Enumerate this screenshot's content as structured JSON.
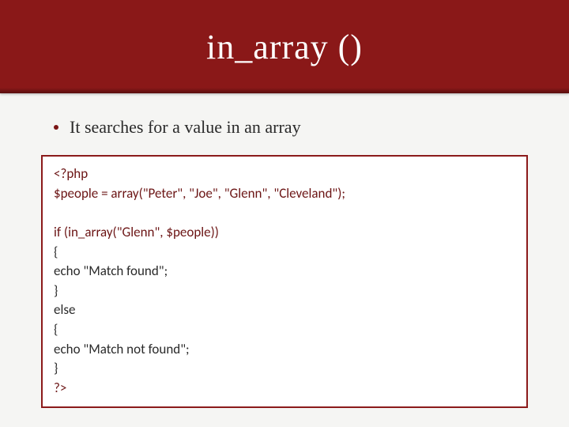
{
  "header": {
    "title": "in_array ()"
  },
  "bullet": {
    "text": "It searches for a value  in an array"
  },
  "code": {
    "line1": "<?php",
    "line2": "$people = array(\"Peter\", \"Joe\", \"Glenn\", \"Cleveland\");",
    "line3": "",
    "line4": "if (in_array(\"Glenn\", $people))",
    "line5": "  {",
    "line6": "  echo \"Match found\";",
    "line7": "  }",
    "line8": "else",
    "line9": "  {",
    "line10": "  echo \"Match not found\";",
    "line11": "  }",
    "line12": "?>"
  }
}
